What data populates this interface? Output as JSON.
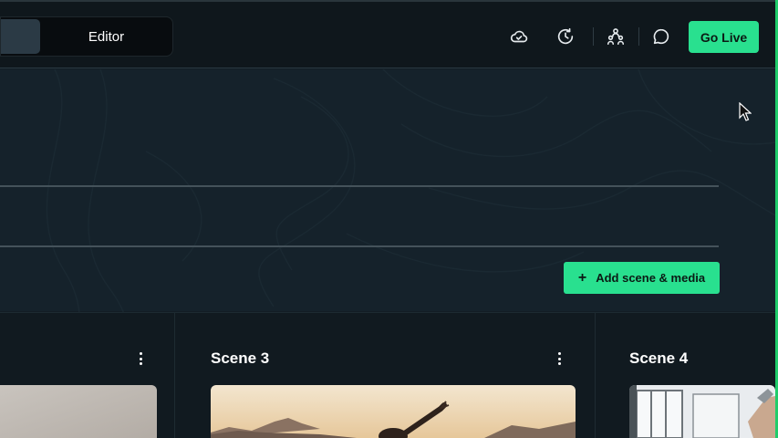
{
  "header": {
    "editor_tab": "Editor",
    "icons": [
      "cloud-icon",
      "history-icon",
      "collaborators-icon",
      "comment-icon"
    ],
    "go_live_label": "Go Live"
  },
  "toolbar": {
    "add_scene_label": "Add scene & media"
  },
  "scenes": [
    {
      "title": ""
    },
    {
      "title": "Scene 3"
    },
    {
      "title": "Scene 4"
    }
  ],
  "colors": {
    "accent": "#29e08f",
    "background": "#131d24",
    "topbar": "#0f171c"
  }
}
